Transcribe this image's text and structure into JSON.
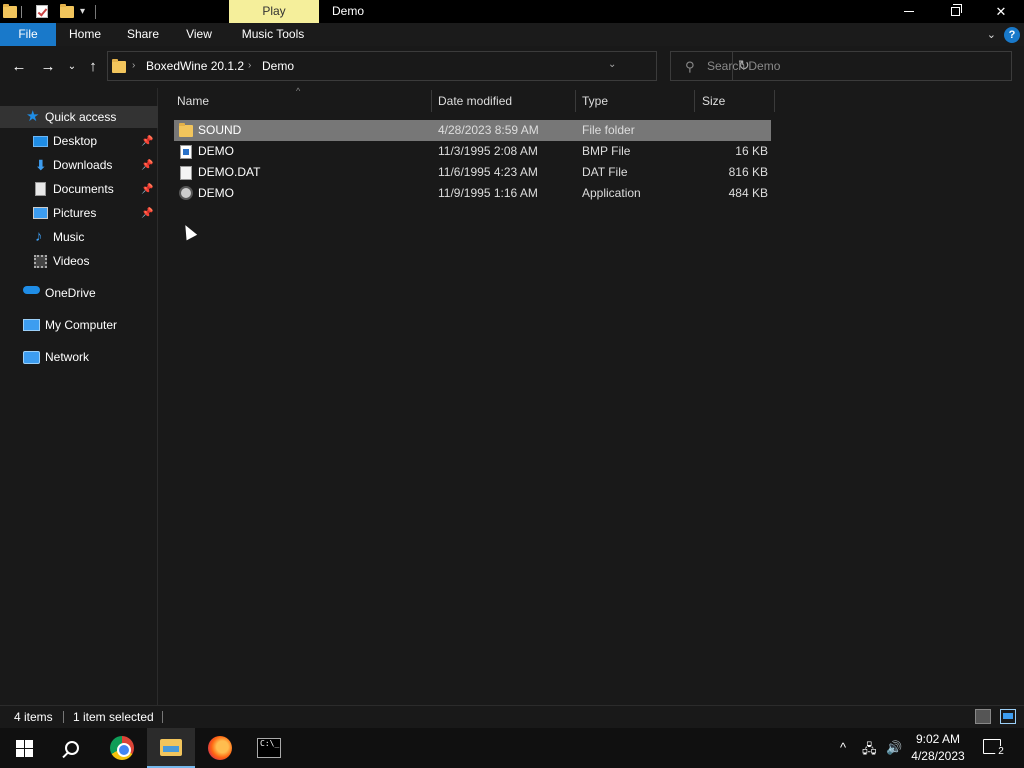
{
  "titlebar": {
    "context_tab": "Play",
    "title": "Demo",
    "minimize": "—",
    "close": "✕"
  },
  "ribbon": {
    "tabs": [
      {
        "label": "File"
      },
      {
        "label": "Home"
      },
      {
        "label": "Share"
      },
      {
        "label": "View"
      },
      {
        "label": "Music Tools"
      }
    ],
    "expand": "⌄",
    "help": "?"
  },
  "nav": {
    "back": "←",
    "forward": "→",
    "recent": "⌄",
    "up": "↑",
    "breadcrumb": [
      "BoxedWine 20.1.2",
      "Demo"
    ],
    "crumb_sep": "›",
    "refresh": "↻",
    "search_placeholder": "Search Demo"
  },
  "sidebar": {
    "items": [
      {
        "label": "Quick access",
        "icon": "star-icon"
      },
      {
        "label": "Desktop",
        "icon": "desktop-icon",
        "pinned": true
      },
      {
        "label": "Downloads",
        "icon": "download-icon",
        "pinned": true
      },
      {
        "label": "Documents",
        "icon": "documents-icon",
        "pinned": true
      },
      {
        "label": "Pictures",
        "icon": "pictures-icon",
        "pinned": true
      },
      {
        "label": "Music",
        "icon": "music-icon"
      },
      {
        "label": "Videos",
        "icon": "videos-icon"
      },
      {
        "label": "OneDrive",
        "icon": "onedrive-icon"
      },
      {
        "label": "My Computer",
        "icon": "computer-icon"
      },
      {
        "label": "Network",
        "icon": "network-icon"
      }
    ]
  },
  "columns": {
    "name": "Name",
    "date": "Date modified",
    "type": "Type",
    "size": "Size"
  },
  "files": [
    {
      "name": "SOUND",
      "date": "4/28/2023 8:59 AM",
      "type": "File folder",
      "size": "",
      "icon": "folder-icon",
      "selected": true
    },
    {
      "name": "DEMO",
      "date": "11/3/1995 2:08 AM",
      "type": "BMP File",
      "size": "16 KB",
      "icon": "bmp-file-icon"
    },
    {
      "name": "DEMO.DAT",
      "date": "11/6/1995 4:23 AM",
      "type": "DAT File",
      "size": "816 KB",
      "icon": "dat-file-icon"
    },
    {
      "name": "DEMO",
      "date": "11/9/1995 1:16 AM",
      "type": "Application",
      "size": "484 KB",
      "icon": "application-icon"
    }
  ],
  "status": {
    "count": "4 items",
    "selection": "1 item selected"
  },
  "taskbar": {
    "time": "9:02 AM",
    "date": "4/28/2023",
    "notifications": "2"
  },
  "colors": {
    "accent": "#1979ca",
    "context_tab": "#f5ef9b",
    "folder": "#f2c55c",
    "selection": "#777777"
  }
}
